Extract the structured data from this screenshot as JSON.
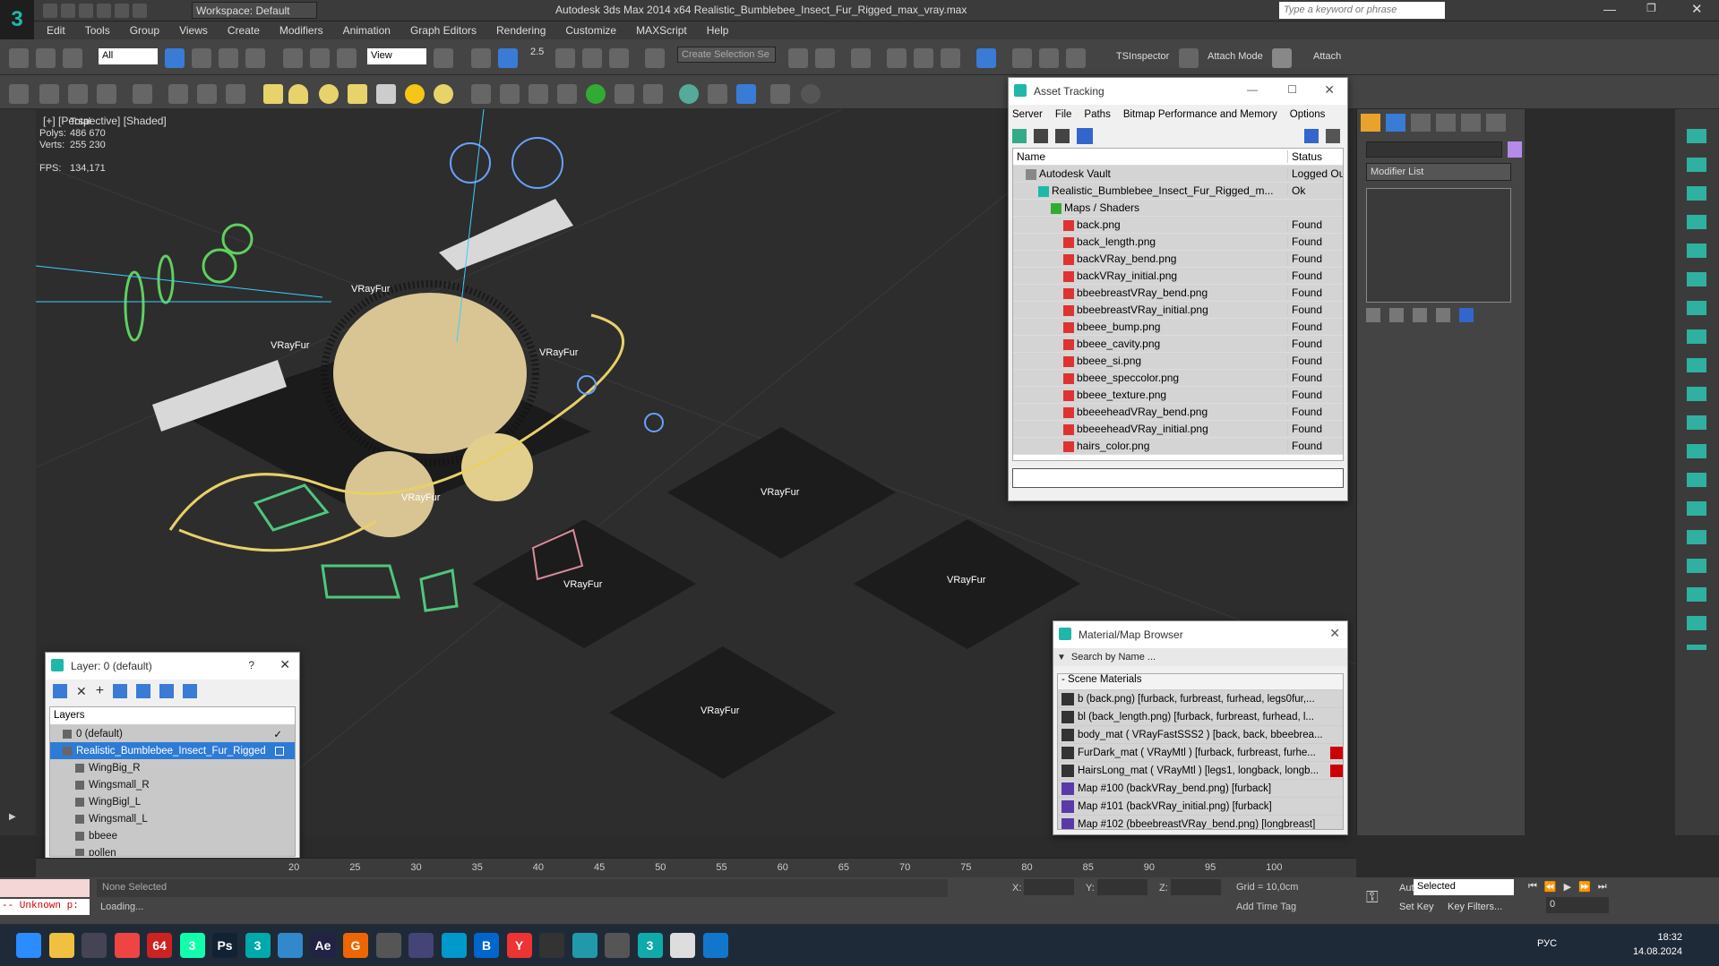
{
  "app": {
    "title": "Autodesk 3ds Max  2014 x64     Realistic_Bumblebee_Insect_Fur_Rigged_max_vray.max",
    "workspace": "Workspace: Default",
    "search_placeholder": "Type a keyword or phrase",
    "logo_glyph": "3"
  },
  "menu": [
    "Edit",
    "Tools",
    "Group",
    "Views",
    "Create",
    "Modifiers",
    "Animation",
    "Graph Editors",
    "Rendering",
    "Customize",
    "MAXScript",
    "Help"
  ],
  "toolbar": {
    "selection_filter": "All",
    "ref_coord": "View",
    "create_selection_set": "Create Selection Se",
    "snap_label": "2.5",
    "ts_inspector": "TSInspector",
    "attach_mode": "Attach Mode",
    "attach": "Attach"
  },
  "viewport": {
    "label": "[+] [Perspective] [Shaded]",
    "stats": {
      "total_label": "Total",
      "polys_label": "Polys:",
      "polys_value": "486 670",
      "verts_label": "Verts:",
      "verts_value": "255 230",
      "fps_label": "FPS:",
      "fps_value": "134,171"
    },
    "fur_label": "VRayFur"
  },
  "asset_tracking": {
    "title": "Asset Tracking",
    "menu": [
      "Server",
      "File",
      "Paths",
      "Bitmap Performance and Memory",
      "Options"
    ],
    "col_name": "Name",
    "col_status": "Status",
    "rows": [
      {
        "name": "Autodesk Vault",
        "status": "Logged Ou",
        "indent": 1
      },
      {
        "name": "Realistic_Bumblebee_Insect_Fur_Rigged_m...",
        "status": "Ok",
        "indent": 2
      },
      {
        "name": "Maps / Shaders",
        "status": "",
        "indent": 3
      },
      {
        "name": "back.png",
        "status": "Found",
        "indent": 4
      },
      {
        "name": "back_length.png",
        "status": "Found",
        "indent": 4
      },
      {
        "name": "backVRay_bend.png",
        "status": "Found",
        "indent": 4
      },
      {
        "name": "backVRay_initial.png",
        "status": "Found",
        "indent": 4
      },
      {
        "name": "bbeebreastVRay_bend.png",
        "status": "Found",
        "indent": 4
      },
      {
        "name": "bbeebreastVRay_initial.png",
        "status": "Found",
        "indent": 4
      },
      {
        "name": "bbeee_bump.png",
        "status": "Found",
        "indent": 4
      },
      {
        "name": "bbeee_cavity.png",
        "status": "Found",
        "indent": 4
      },
      {
        "name": "bbeee_si.png",
        "status": "Found",
        "indent": 4
      },
      {
        "name": "bbeee_speccolor.png",
        "status": "Found",
        "indent": 4
      },
      {
        "name": "bbeee_texture.png",
        "status": "Found",
        "indent": 4
      },
      {
        "name": "bbeeeheadVRay_bend.png",
        "status": "Found",
        "indent": 4
      },
      {
        "name": "bbeeeheadVRay_initial.png",
        "status": "Found",
        "indent": 4
      },
      {
        "name": "hairs_color.png",
        "status": "Found",
        "indent": 4
      }
    ]
  },
  "material_browser": {
    "title": "Material/Map Browser",
    "search_placeholder": "Search by Name ...",
    "group": "- Scene Materials",
    "items": [
      {
        "label": "b (back.png) [furback, furbreast, furhead, legs0fur,...",
        "red": false
      },
      {
        "label": "bl (back_length.png) [furback, furbreast, furhead, l...",
        "red": false
      },
      {
        "label": "body_mat  ( VRayFastSSS2 ) [back, back, bbeebrea...",
        "red": false
      },
      {
        "label": "FurDark_mat  ( VRayMtl ) [furback, furbreast, furhe...",
        "red": true
      },
      {
        "label": "HairsLong_mat  ( VRayMtl ) [legs1, longback, longb...",
        "red": true
      },
      {
        "label": "Map #100 (backVRay_bend.png) [furback]",
        "red": false
      },
      {
        "label": "Map #101 (backVRay_initial.png) [furback]",
        "red": false
      },
      {
        "label": "Map #102 (bbeebreastVRay_bend.png) [longbreast]",
        "red": false
      }
    ]
  },
  "layer_panel": {
    "title": "Layer: 0 (default)",
    "help": "?",
    "header": "Layers",
    "rows": [
      {
        "label": "0 (default)",
        "selected": false
      },
      {
        "label": "Realistic_Bumblebee_Insect_Fur_Rigged",
        "selected": true
      },
      {
        "label": "WingBig_R",
        "selected": false
      },
      {
        "label": "Wingsmall_R",
        "selected": false
      },
      {
        "label": "WingBigl_L",
        "selected": false
      },
      {
        "label": "Wingsmall_L",
        "selected": false
      },
      {
        "label": "bbeee",
        "selected": false
      },
      {
        "label": "pollen",
        "selected": false
      }
    ]
  },
  "command_panel": {
    "modifier_list": "Modifier List"
  },
  "timeline": {
    "ticks": [
      "20",
      "25",
      "30",
      "35",
      "40",
      "45",
      "50",
      "55",
      "60",
      "65",
      "70",
      "75",
      "80",
      "85",
      "90",
      "95",
      "100"
    ]
  },
  "status": {
    "maxscript": "-- Unknown p:",
    "selection": "None Selected",
    "prompt": "Loading...",
    "x_label": "X:",
    "y_label": "Y:",
    "z_label": "Z:",
    "grid": "Grid = 10,0cm",
    "add_time_tag": "Add Time Tag",
    "auto_key": "Auto Key",
    "set_key": "Set Key",
    "selected": "Selected",
    "key_filters": "Key Filters...",
    "frame": "0"
  },
  "taskbar": {
    "lang": "РУС",
    "time": "18:32",
    "date": "14.08.2024",
    "icons": [
      {
        "name": "windows-start-icon",
        "glyph": "",
        "color": "#2a8cff"
      },
      {
        "name": "file-explorer-icon",
        "glyph": "",
        "color": "#f0c040"
      },
      {
        "name": "task-view-icon",
        "glyph": "",
        "color": "#445"
      },
      {
        "name": "chrome-icon",
        "glyph": "",
        "color": "#e44"
      },
      {
        "name": "app-64-icon",
        "glyph": "64",
        "color": "#c22"
      },
      {
        "name": "3dsmax-icon",
        "glyph": "3",
        "color": "#1fa"
      },
      {
        "name": "photoshop-icon",
        "glyph": "Ps",
        "color": "#123"
      },
      {
        "name": "3dsmax-active-icon",
        "glyph": "3",
        "color": "#0aa"
      },
      {
        "name": "notepad-icon",
        "glyph": "",
        "color": "#38c"
      },
      {
        "name": "after-effects-icon",
        "glyph": "Ae",
        "color": "#224"
      },
      {
        "name": "app-g-icon",
        "glyph": "G",
        "color": "#e60"
      },
      {
        "name": "search-app-icon",
        "glyph": "",
        "color": "#555"
      },
      {
        "name": "save-app-icon",
        "glyph": "",
        "color": "#447"
      },
      {
        "name": "edge-icon",
        "glyph": "",
        "color": "#09c"
      },
      {
        "name": "app-b-icon",
        "glyph": "B",
        "color": "#06c"
      },
      {
        "name": "yandex-icon",
        "glyph": "Y",
        "color": "#e33"
      },
      {
        "name": "terminal-icon",
        "glyph": "",
        "color": "#333"
      },
      {
        "name": "telegram-icon",
        "glyph": "",
        "color": "#29a"
      },
      {
        "name": "calculator-icon",
        "glyph": "",
        "color": "#555"
      },
      {
        "name": "3dsmax-2-icon",
        "glyph": "3",
        "color": "#1aa"
      },
      {
        "name": "document-icon",
        "glyph": "",
        "color": "#ddd"
      },
      {
        "name": "camera-app-icon",
        "glyph": "",
        "color": "#17c"
      }
    ]
  }
}
